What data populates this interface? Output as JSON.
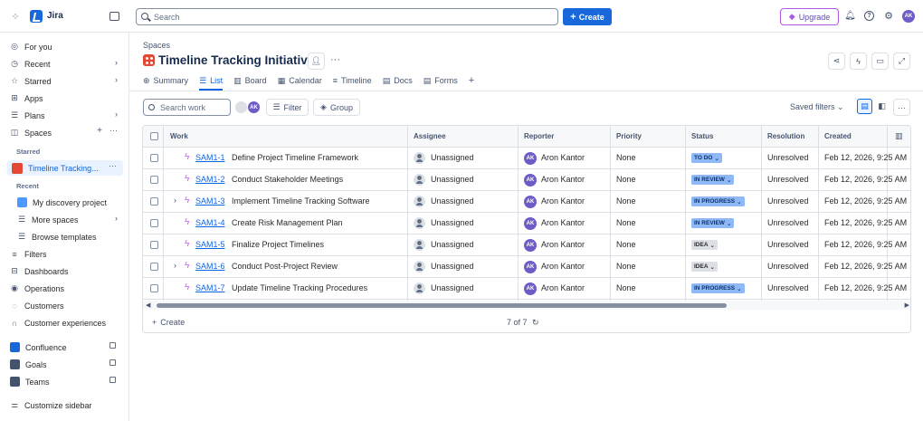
{
  "topbar": {
    "app_name": "Jira",
    "search_placeholder": "Search",
    "create_label": "Create",
    "upgrade_label": "Upgrade",
    "user_initials": "AK"
  },
  "sidebar": {
    "items": [
      {
        "label": "For you",
        "icon": "person-circle-icon"
      },
      {
        "label": "Recent",
        "icon": "clock-icon"
      },
      {
        "label": "Starred",
        "icon": "star-icon"
      },
      {
        "label": "Apps",
        "icon": "apps-icon"
      },
      {
        "label": "Plans",
        "icon": "plans-icon"
      },
      {
        "label": "Spaces",
        "icon": "spaces-icon"
      }
    ],
    "starred_heading": "Starred",
    "starred_item": "Timeline Tracking...",
    "recent_heading": "Recent",
    "recent_items": [
      "My discovery project",
      "More spaces",
      "Browse templates"
    ],
    "bottom_items": [
      "Filters",
      "Dashboards",
      "Operations",
      "Customers",
      "Customer experiences"
    ],
    "apps": [
      "Confluence",
      "Goals",
      "Teams"
    ],
    "customize": "Customize sidebar"
  },
  "main": {
    "breadcrumb": "Spaces",
    "title": "Timeline Tracking Initiatives",
    "tabs": [
      "Summary",
      "List",
      "Board",
      "Calendar",
      "Timeline",
      "Docs",
      "Forms"
    ],
    "search_placeholder": "Search work",
    "filter_label": "Filter",
    "group_label": "Group",
    "saved_filters_label": "Saved filters",
    "filter_avatar_initials": "AK"
  },
  "table": {
    "headers": [
      "Work",
      "Assignee",
      "Reporter",
      "Priority",
      "Status",
      "Resolution",
      "Created"
    ],
    "rows": [
      {
        "key": "SAM1-1",
        "summary": "Define Project Timeline Framework",
        "assignee": "Unassigned",
        "reporter": "Aron Kantor",
        "reporter_initials": "AK",
        "priority": "None",
        "status": "TO DO",
        "resolution": "Unresolved",
        "created": "Feb 12, 2026, 9:25 AM",
        "expandable": false
      },
      {
        "key": "SAM1-2",
        "summary": "Conduct Stakeholder Meetings",
        "assignee": "Unassigned",
        "reporter": "Aron Kantor",
        "reporter_initials": "AK",
        "priority": "None",
        "status": "IN REVIEW",
        "resolution": "Unresolved",
        "created": "Feb 12, 2026, 9:25 AM",
        "expandable": false
      },
      {
        "key": "SAM1-3",
        "summary": "Implement Timeline Tracking Software",
        "assignee": "Unassigned",
        "reporter": "Aron Kantor",
        "reporter_initials": "AK",
        "priority": "None",
        "status": "IN PROGRESS",
        "resolution": "Unresolved",
        "created": "Feb 12, 2026, 9:25 AM",
        "expandable": true
      },
      {
        "key": "SAM1-4",
        "summary": "Create Risk Management Plan",
        "assignee": "Unassigned",
        "reporter": "Aron Kantor",
        "reporter_initials": "AK",
        "priority": "None",
        "status": "IN REVIEW",
        "resolution": "Unresolved",
        "created": "Feb 12, 2026, 9:25 AM",
        "expandable": false
      },
      {
        "key": "SAM1-5",
        "summary": "Finalize Project Timelines",
        "assignee": "Unassigned",
        "reporter": "Aron Kantor",
        "reporter_initials": "AK",
        "priority": "None",
        "status": "IDEA",
        "resolution": "Unresolved",
        "created": "Feb 12, 2026, 9:25 AM",
        "expandable": false
      },
      {
        "key": "SAM1-6",
        "summary": "Conduct Post-Project Review",
        "assignee": "Unassigned",
        "reporter": "Aron Kantor",
        "reporter_initials": "AK",
        "priority": "None",
        "status": "IDEA",
        "resolution": "Unresolved",
        "created": "Feb 12, 2026, 9:25 AM",
        "expandable": true
      },
      {
        "key": "SAM1-7",
        "summary": "Update Timeline Tracking Procedures",
        "assignee": "Unassigned",
        "reporter": "Aron Kantor",
        "reporter_initials": "AK",
        "priority": "None",
        "status": "IN PROGRESS",
        "resolution": "Unresolved",
        "created": "Feb 12, 2026, 9:25 AM",
        "expandable": false
      }
    ],
    "footer_create": "Create",
    "count": "7 of 7"
  },
  "colors": {
    "accent": "#1868db",
    "status_blue": "#8fb8f6",
    "status_gray": "#dcdfe4",
    "upgrade_border": "#af59e1"
  }
}
